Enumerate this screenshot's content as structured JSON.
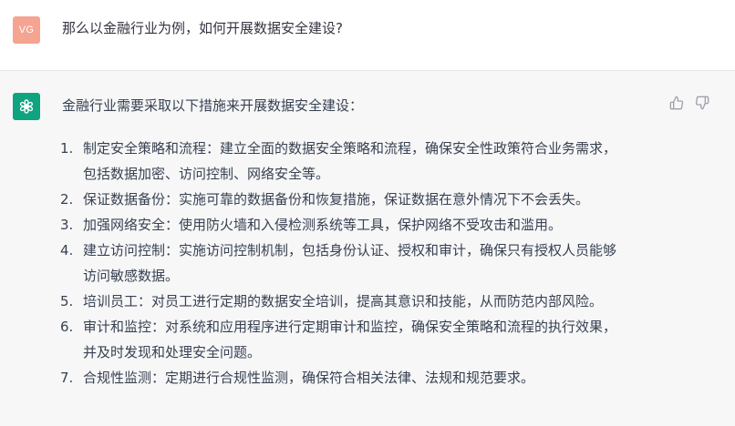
{
  "user": {
    "avatar_initials": "VG",
    "message": "那么以金融行业为例，如何开展数据安全建设?"
  },
  "assistant": {
    "intro": "金融行业需要采取以下措施来开展数据安全建设：",
    "steps": [
      {
        "num": "1.",
        "lines": [
          "制定安全策略和流程：建立全面的数据安全策略和流程，确保安全性政策符合业务需求，",
          "包括数据加密、访问控制、网络安全等。"
        ]
      },
      {
        "num": "2.",
        "lines": [
          "保证数据备份：实施可靠的数据备份和恢复措施，保证数据在意外情况下不会丢失。"
        ]
      },
      {
        "num": "3.",
        "lines": [
          "加强网络安全：使用防火墙和入侵检测系统等工具，保护网络不受攻击和滥用。"
        ]
      },
      {
        "num": "4.",
        "lines": [
          "建立访问控制：实施访问控制机制，包括身份认证、授权和审计，确保只有授权人员能够",
          "访问敏感数据。"
        ]
      },
      {
        "num": "5.",
        "lines": [
          "培训员工：对员工进行定期的数据安全培训，提高其意识和技能，从而防范内部风险。"
        ]
      },
      {
        "num": "6.",
        "lines": [
          "审计和监控：对系统和应用程序进行定期审计和监控，确保安全策略和流程的执行效果，",
          "并及时发现和处理安全问题。"
        ]
      },
      {
        "num": "7.",
        "lines": [
          "合规性监测：定期进行合规性监测，确保符合相关法律、法规和规范要求。"
        ]
      }
    ]
  },
  "colors": {
    "user_avatar": "#f5a492",
    "bot_avatar": "#10a37f",
    "assistant_bg": "#f7f7f8"
  },
  "icons": {
    "bot_avatar": "openai-logo-icon",
    "thumbs_up": "thumbs-up-icon",
    "thumbs_down": "thumbs-down-icon"
  }
}
